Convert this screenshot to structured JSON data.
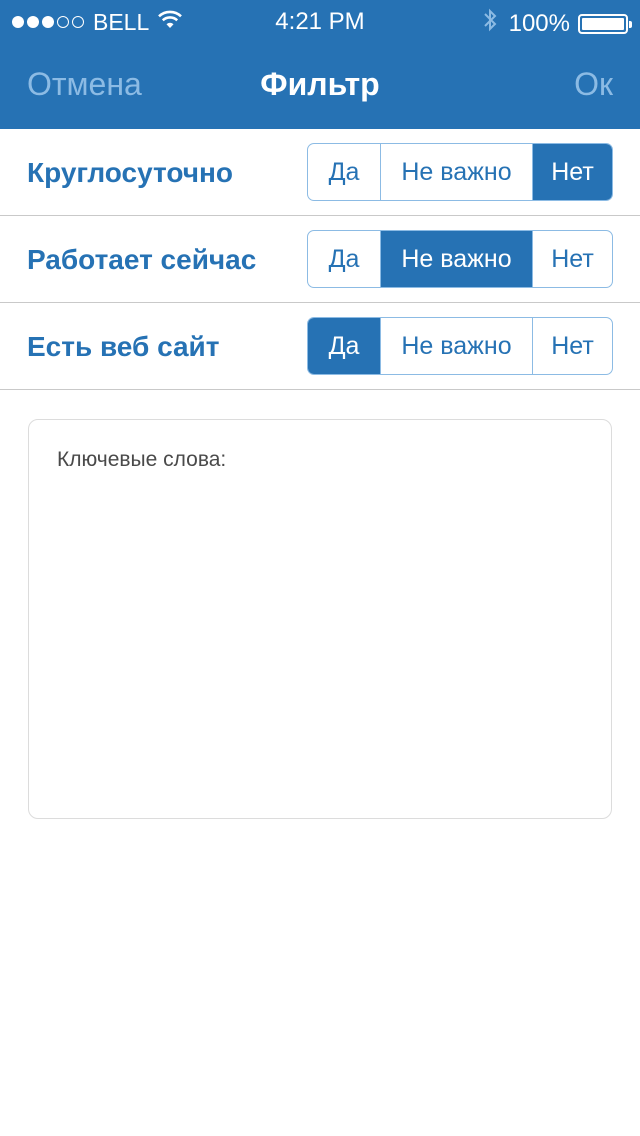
{
  "status_bar": {
    "carrier": "BELL",
    "time": "4:21 PM",
    "battery": "100%",
    "signal_bars_filled": 3,
    "signal_bars_total": 5
  },
  "nav": {
    "cancel": "Отмена",
    "title": "Фильтр",
    "ok": "Ок"
  },
  "filters": [
    {
      "label": "Круглосуточно",
      "options": [
        "Да",
        "Не важно",
        "Нет"
      ],
      "selected": "Нет"
    },
    {
      "label": "Работает сейчас",
      "options": [
        "Да",
        "Не важно",
        "Нет"
      ],
      "selected": "Не важно"
    },
    {
      "label": "Есть веб сайт",
      "options": [
        "Да",
        "Не важно",
        "Нет"
      ],
      "selected": "Да"
    }
  ],
  "keywords": {
    "label": "Ключевые слова:"
  },
  "colors": {
    "accent": "#2672b4",
    "nav_button": "#8cbbe4",
    "divider": "#c9c9c9"
  },
  "icons": [
    "signal-dots-icon",
    "wifi-icon",
    "bluetooth-icon",
    "battery-icon"
  ]
}
